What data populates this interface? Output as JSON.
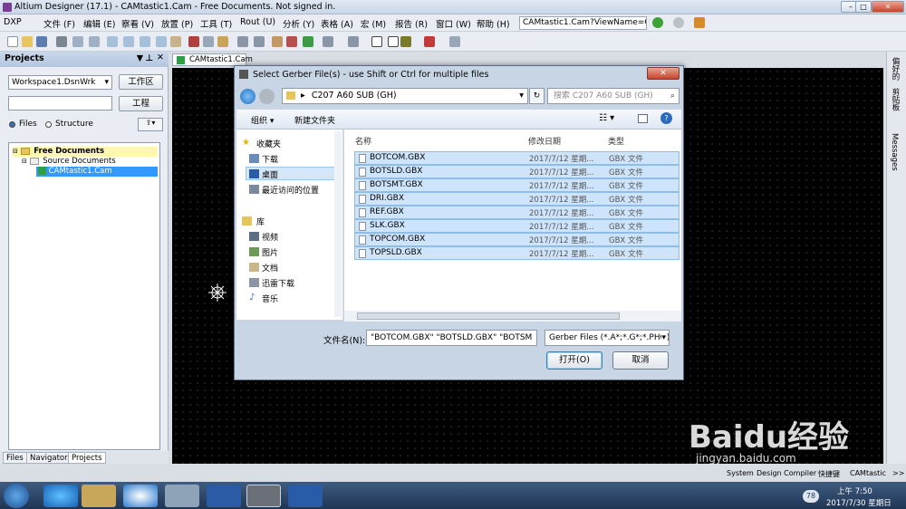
{
  "app": {
    "title": "Altium Designer (17.1) - CAMtastic1.Cam - Free Documents. Not signed in."
  },
  "menu": [
    "DXP",
    "文件 (F)",
    "编辑 (E)",
    "察看 (V)",
    "放置 (P)",
    "工具 (T)",
    "Rout (U)",
    "分析 (Y)",
    "表格 (A)",
    "宏 (M)",
    "报告 (R)",
    "窗口 (W)",
    "帮助 (H)"
  ],
  "url": "CAMtastic1.Cam?ViewName=C",
  "projects": {
    "title": "Projects",
    "workspace": "Workspace1.DsnWrk",
    "workspace_button": "工作区",
    "project_button": "工程",
    "radio_files": "Files",
    "radio_structure": "Structure",
    "tree": {
      "root": "Free Documents",
      "folder": "Source Documents",
      "file": "CAMtastic1.Cam"
    },
    "tabs": [
      "Files",
      "Navigator",
      "Projects"
    ]
  },
  "document_tab": "CAMtastic1.Cam",
  "right_panels": [
    "偏好的",
    "剪贴板",
    "Messages"
  ],
  "status_tabs": [
    "System",
    "Design Compiler",
    "快捷键",
    "CAMtastic",
    ">>"
  ],
  "dialog": {
    "title": "Select Gerber File(s) - use Shift or Ctrl for multiple files",
    "address": "C207 A60 SUB (GH)",
    "search_placeholder": "搜索 C207 A60 SUB (GH)",
    "organize": "组织 ▾",
    "new_folder": "新建文件夹",
    "nav": {
      "favorites": "收藏夹",
      "downloads": "下载",
      "desktop": "桌面",
      "recent": "最近访问的位置",
      "library": "库",
      "videos": "视频",
      "pictures": "图片",
      "documents": "文档",
      "thunder": "迅雷下载",
      "music": "音乐"
    },
    "columns": {
      "name": "名称",
      "date": "修改日期",
      "type": "类型"
    },
    "files": [
      {
        "name": "BOTCOM.GBX",
        "date": "2017/7/12 星期...",
        "type": "GBX 文件"
      },
      {
        "name": "BOTSLD.GBX",
        "date": "2017/7/12 星期...",
        "type": "GBX 文件"
      },
      {
        "name": "BOTSMT.GBX",
        "date": "2017/7/12 星期...",
        "type": "GBX 文件"
      },
      {
        "name": "DRI.GBX",
        "date": "2017/7/12 星期...",
        "type": "GBX 文件"
      },
      {
        "name": "REF.GBX",
        "date": "2017/7/12 星期...",
        "type": "GBX 文件"
      },
      {
        "name": "SLK.GBX",
        "date": "2017/7/12 星期...",
        "type": "GBX 文件"
      },
      {
        "name": "TOPCOM.GBX",
        "date": "2017/7/12 星期...",
        "type": "GBX 文件"
      },
      {
        "name": "TOPSLD.GBX",
        "date": "2017/7/12 星期...",
        "type": "GBX 文件"
      }
    ],
    "filename_label": "文件名(N):",
    "filename_value": "\"BOTCOM.GBX\" \"BOTSLD.GBX\" \"BOTSM",
    "filetype": "Gerber Files (*.A*;*.G*;*.PHO)",
    "open_button": "打开(O)",
    "cancel_button": "取消"
  },
  "taskbar": {
    "time": "上午 7:50",
    "date": "2017/7/30 星期日",
    "badge": "78"
  },
  "watermark": {
    "brand": "Baidu经验",
    "url": "jingyan.baidu.com"
  }
}
